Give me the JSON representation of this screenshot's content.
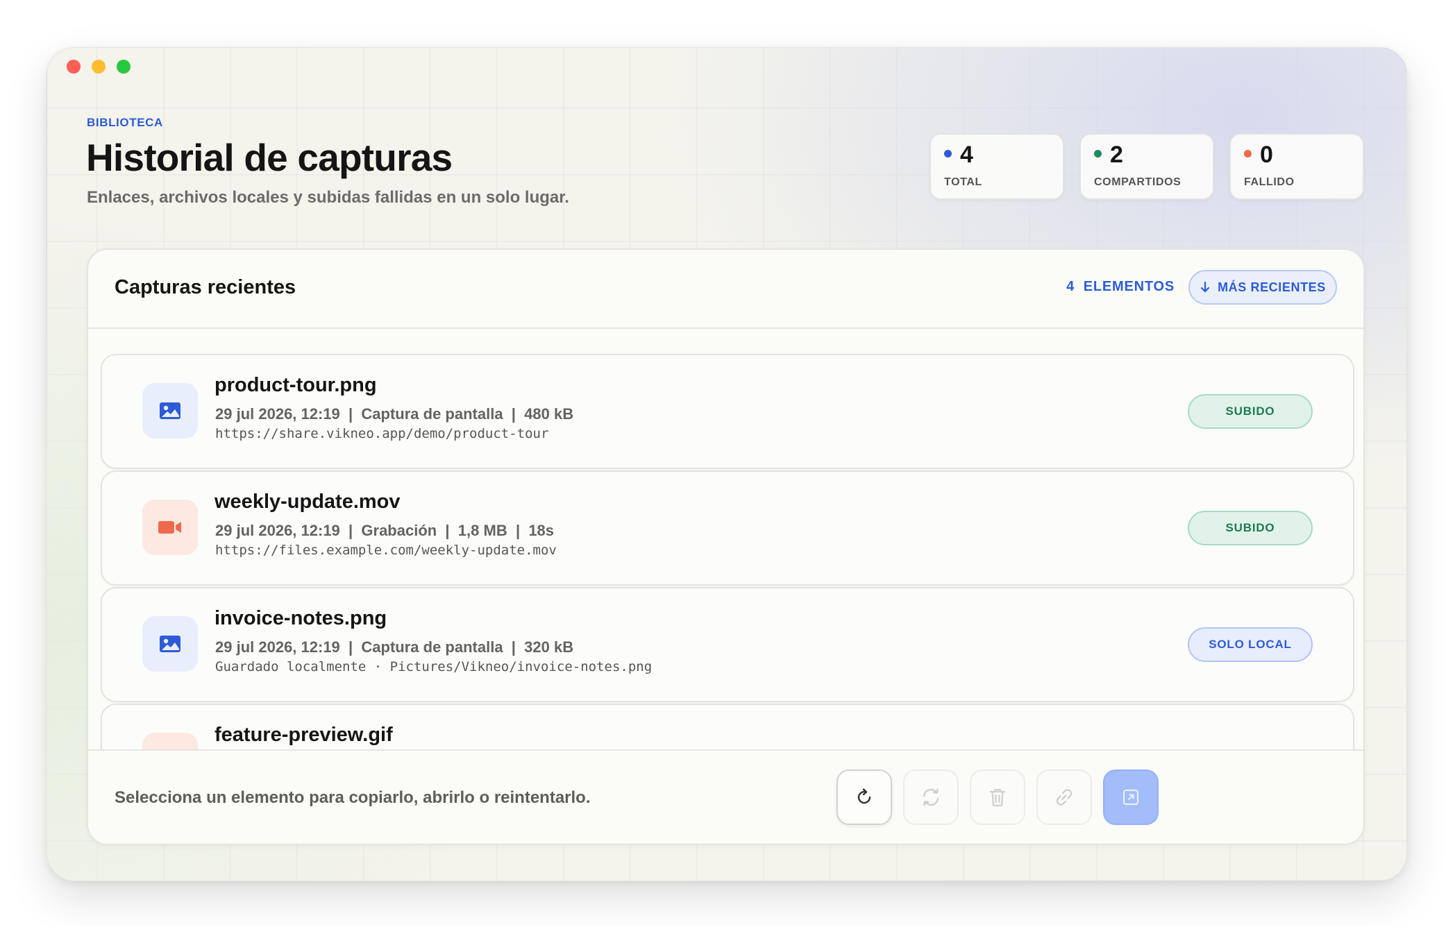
{
  "header": {
    "eyebrow": "BIBLIOTECA",
    "title": "Historial de capturas",
    "subtitle": "Enlaces, archivos locales y subidas fallidas en un solo lugar."
  },
  "stats": [
    {
      "value": "4",
      "label": "TOTAL",
      "dot_color": "#2d5bd8"
    },
    {
      "value": "2",
      "label": "COMPARTIDOS",
      "dot_color": "#1f8a5b"
    },
    {
      "value": "0",
      "label": "FALLIDO",
      "dot_color": "#ef6a4d"
    }
  ],
  "panel": {
    "title": "Capturas recientes",
    "count_label": "4  ELEMENTOS",
    "sort_label": "MÁS RECIENTES"
  },
  "items": [
    {
      "name": "product-tour.png",
      "meta": "29 jul 2026, 12:19  |  Captura de pantalla  |  480 kB",
      "url": "https://share.vikneo.app/demo/product-tour",
      "status": "SUBIDO",
      "kind": "image-icon"
    },
    {
      "name": "weekly-update.mov",
      "meta": "29 jul 2026, 12:19  |  Grabación  |  1,8 MB  |  18s",
      "url": "https://files.example.com/weekly-update.mov",
      "status": "SUBIDO",
      "kind": "video-camera-icon"
    },
    {
      "name": "invoice-notes.png",
      "meta": "29 jul 2026, 12:19  |  Captura de pantalla  |  320 kB",
      "url": "Guardado localmente · Pictures/Vikneo/invoice-notes.png",
      "status": "SOLO LOCAL",
      "kind": "image-icon"
    },
    {
      "name": "feature-preview.gif",
      "meta": "",
      "url": "",
      "status": "",
      "kind": "video-camera-icon"
    }
  ],
  "footer": {
    "hint": "Selecciona un elemento para copiarlo, abrirlo o reintentarlo.",
    "actions": [
      "refresh-icon",
      "retry-icon",
      "trash-icon",
      "link-icon",
      "open-external-icon"
    ]
  },
  "colors": {
    "accent": "#2d5bd8",
    "success": "#1f8a5b",
    "danger": "#ef6a4d",
    "primary_button": "#a3bcfa"
  }
}
